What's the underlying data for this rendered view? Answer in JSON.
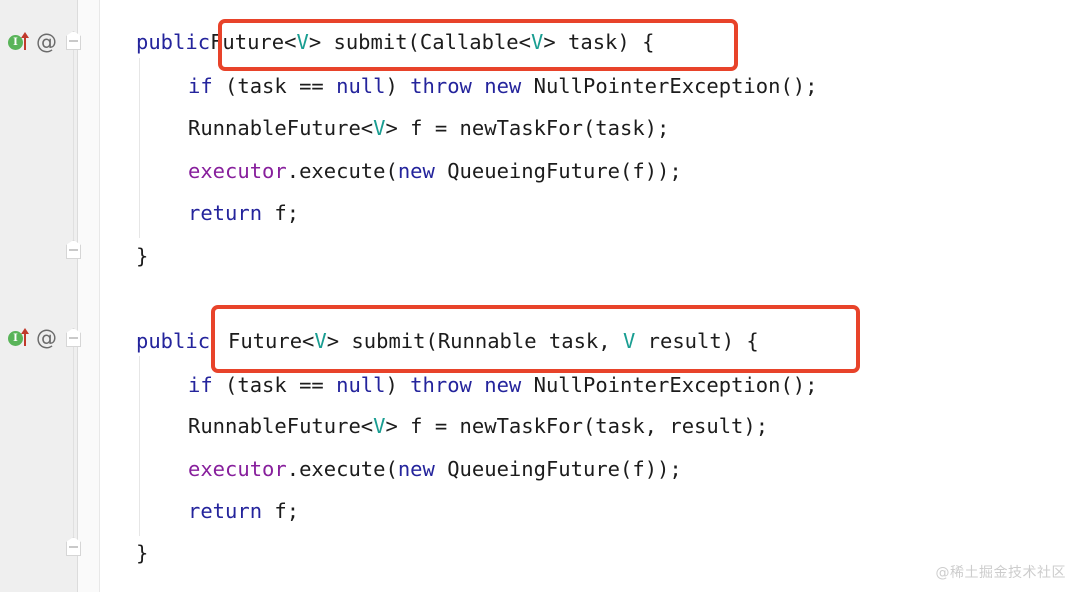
{
  "editor": {
    "background_color": "#ffffff",
    "gutter_color": "#efefef",
    "highlight_color": "#e8432a",
    "keyword_color": "#24249c",
    "generic_type_color": "#1a9e92",
    "field_color": "#871f9c"
  },
  "gutter": {
    "markers": [
      {
        "implementation_icon": "I",
        "icon_names": [
          "implemented-method-icon",
          "override-up-arrow-icon",
          "annotation-at-icon"
        ]
      },
      {
        "implementation_icon": "I",
        "icon_names": [
          "implemented-method-icon",
          "override-up-arrow-icon",
          "annotation-at-icon"
        ]
      }
    ],
    "at_symbol": "@"
  },
  "code": {
    "method_one": {
      "signature": {
        "modifier": "public",
        "return_type": "Future",
        "generic": "V",
        "rest": "> submit(Callable<",
        "generic2": "V",
        "tail": "> task) {",
        "full_text": "public Future<V> submit(Callable<V> task) {"
      },
      "lines": [
        {
          "parts": [
            {
              "text": "if",
              "style": "kw"
            },
            {
              "text": " (task == ",
              "style": "plain"
            },
            {
              "text": "null",
              "style": "kw"
            },
            {
              "text": ") ",
              "style": "plain"
            },
            {
              "text": "throw",
              "style": "kw"
            },
            {
              "text": " ",
              "style": "plain"
            },
            {
              "text": "new",
              "style": "kw"
            },
            {
              "text": " NullPointerException();",
              "style": "plain"
            }
          ],
          "full_text": "if (task == null) throw new NullPointerException();"
        },
        {
          "parts": [
            {
              "text": "RunnableFuture<",
              "style": "plain"
            },
            {
              "text": "V",
              "style": "gen"
            },
            {
              "text": "> f = newTaskFor(task);",
              "style": "plain"
            }
          ],
          "full_text": "RunnableFuture<V> f = newTaskFor(task);"
        },
        {
          "parts": [
            {
              "text": "executor",
              "style": "field"
            },
            {
              "text": ".execute(",
              "style": "plain"
            },
            {
              "text": "new",
              "style": "kw"
            },
            {
              "text": " QueueingFuture(f));",
              "style": "plain"
            }
          ],
          "full_text": "executor.execute(new QueueingFuture(f));"
        },
        {
          "parts": [
            {
              "text": "return",
              "style": "kw"
            },
            {
              "text": " f;",
              "style": "plain"
            }
          ],
          "full_text": "return f;"
        }
      ],
      "closing_brace": "}"
    },
    "method_two": {
      "signature": {
        "modifier": "public",
        "full_text": "public Future<V> submit(Runnable task, V result) {"
      },
      "lines": [
        {
          "parts": [
            {
              "text": "if",
              "style": "kw"
            },
            {
              "text": " (task == ",
              "style": "plain"
            },
            {
              "text": "null",
              "style": "kw"
            },
            {
              "text": ") ",
              "style": "plain"
            },
            {
              "text": "throw",
              "style": "kw"
            },
            {
              "text": " ",
              "style": "plain"
            },
            {
              "text": "new",
              "style": "kw"
            },
            {
              "text": " NullPointerException();",
              "style": "plain"
            }
          ],
          "full_text": "if (task == null) throw new NullPointerException();"
        },
        {
          "parts": [
            {
              "text": "RunnableFuture<",
              "style": "plain"
            },
            {
              "text": "V",
              "style": "gen"
            },
            {
              "text": "> f = newTaskFor(task, result);",
              "style": "plain"
            }
          ],
          "full_text": "RunnableFuture<V> f = newTaskFor(task, result);"
        },
        {
          "parts": [
            {
              "text": "executor",
              "style": "field"
            },
            {
              "text": ".execute(",
              "style": "plain"
            },
            {
              "text": "new",
              "style": "kw"
            },
            {
              "text": " QueueingFuture(f));",
              "style": "plain"
            }
          ],
          "full_text": "executor.execute(new QueueingFuture(f));"
        },
        {
          "parts": [
            {
              "text": "return",
              "style": "kw"
            },
            {
              "text": " f;",
              "style": "plain"
            }
          ],
          "full_text": "return f;"
        }
      ],
      "closing_brace": "}"
    }
  },
  "segments": {
    "sig1": [
      {
        "text": "Future<",
        "style": "plain"
      },
      {
        "text": "V",
        "style": "gen"
      },
      {
        "text": "> submit(Callable<",
        "style": "plain"
      },
      {
        "text": "V",
        "style": "gen"
      },
      {
        "text": "> task) {",
        "style": "plain"
      }
    ],
    "sig2": [
      {
        "text": "Future<",
        "style": "plain"
      },
      {
        "text": "V",
        "style": "gen"
      },
      {
        "text": "> submit(Runnable task, ",
        "style": "plain"
      },
      {
        "text": "V",
        "style": "gen"
      },
      {
        "text": " result) {",
        "style": "plain"
      }
    ]
  },
  "watermark": {
    "text": "@稀土掘金技术社区"
  }
}
